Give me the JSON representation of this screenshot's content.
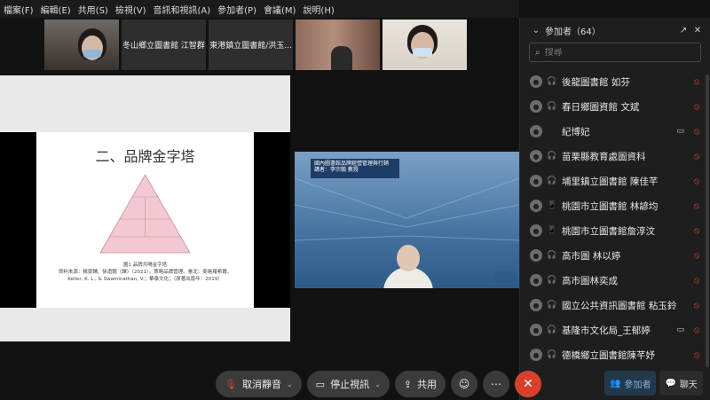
{
  "menu": [
    "檔案(F)",
    "編輯(E)",
    "共用(S)",
    "檢視(V)",
    "音訊和視訊(A)",
    "參加者(P)",
    "會議(M)",
    "說明(H)"
  ],
  "thumbnails": [
    {
      "name": ""
    },
    {
      "name": "冬山鄉立圖書館 江智群"
    },
    {
      "name": "東港鎮立圖書館/洪玉..."
    },
    {
      "name": ""
    },
    {
      "name": ""
    }
  ],
  "slide": {
    "title": "二、品牌金字塔",
    "caption_lines": [
      "圖1 品牌共鳴金字塔",
      "資料來源：楊景輔、徐迺聰（譯）（2021）。策略品牌管理。臺北：麥格羅希爾。",
      "Keller, K. L., & Swaminathan, V.；華泰文化；（原著出版年：2019）"
    ]
  },
  "video_banner": [
    "國內圖書館品牌經營管理與行銷",
    "講者：李宗翰 教授"
  ],
  "participants_panel": {
    "title": "參加者（64）",
    "search_placeholder": "搜尋",
    "participants": [
      {
        "name": "後龍圖書館 如芬",
        "device": "headset",
        "muted": true,
        "camera": false
      },
      {
        "name": "春日鄉圖資館 文斌",
        "device": "headset",
        "muted": true,
        "camera": false
      },
      {
        "name": "紀博妃",
        "device": "",
        "muted": false,
        "camera": true
      },
      {
        "name": "苗栗縣教育處圖資科",
        "device": "headset",
        "muted": true,
        "camera": false
      },
      {
        "name": "埔里鎮立圖書館 陳佳芊",
        "device": "headset",
        "muted": true,
        "camera": false
      },
      {
        "name": "桃園市立圖書館 林諺均",
        "device": "phone",
        "muted": true,
        "camera": false
      },
      {
        "name": "桃園市立圖書館詹淳汶",
        "device": "phone",
        "muted": true,
        "camera": false
      },
      {
        "name": "高市圖 林以婷",
        "device": "headset",
        "muted": true,
        "camera": false
      },
      {
        "name": "高市圖林奕成",
        "device": "headset",
        "muted": true,
        "camera": false
      },
      {
        "name": "國立公共資訊圖書館 粘玉鈴",
        "device": "headset",
        "muted": true,
        "camera": false
      },
      {
        "name": "基隆市文化局_王郁婷",
        "device": "headset",
        "muted": false,
        "camera": true
      },
      {
        "name": "德橋鄉立圖書館陳芊妤",
        "device": "headset",
        "muted": true,
        "camera": false
      }
    ]
  },
  "toolbar": {
    "unmute_label": "取消靜音",
    "stop_video_label": "停止視訊",
    "share_label": "共用"
  },
  "panel_tabs": {
    "participants_label": "參加者",
    "chat_label": "聊天"
  },
  "colors": {
    "mute_red": "#e0472f",
    "end_call": "#d9402b",
    "active_tab": "#7fb6e6"
  }
}
